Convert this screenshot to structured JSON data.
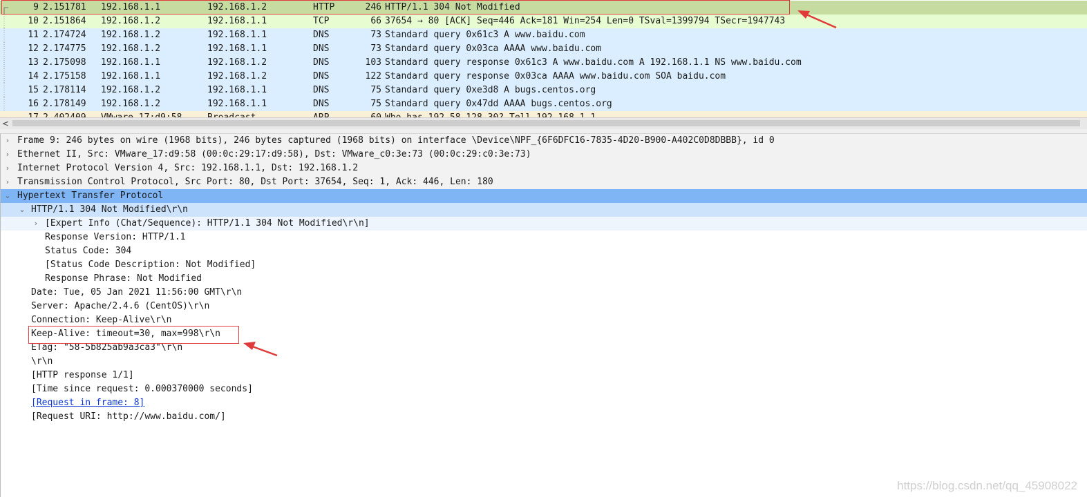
{
  "packet_list": {
    "rows": [
      {
        "no": "9",
        "time": "2.151781",
        "src": "192.168.1.1",
        "dst": "192.168.1.2",
        "proto": "HTTP",
        "len": "246",
        "info": "HTTP/1.1 304 Not Modified"
      },
      {
        "no": "10",
        "time": "2.151864",
        "src": "192.168.1.2",
        "dst": "192.168.1.1",
        "proto": "TCP",
        "len": "66",
        "info": "37654 → 80 [ACK] Seq=446 Ack=181 Win=254 Len=0 TSval=1399794 TSecr=1947743"
      },
      {
        "no": "11",
        "time": "2.174724",
        "src": "192.168.1.2",
        "dst": "192.168.1.1",
        "proto": "DNS",
        "len": "73",
        "info": "Standard query 0x61c3 A www.baidu.com"
      },
      {
        "no": "12",
        "time": "2.174775",
        "src": "192.168.1.2",
        "dst": "192.168.1.1",
        "proto": "DNS",
        "len": "73",
        "info": "Standard query 0x03ca AAAA www.baidu.com"
      },
      {
        "no": "13",
        "time": "2.175098",
        "src": "192.168.1.1",
        "dst": "192.168.1.2",
        "proto": "DNS",
        "len": "103",
        "info": "Standard query response 0x61c3 A www.baidu.com A 192.168.1.1 NS www.baidu.com"
      },
      {
        "no": "14",
        "time": "2.175158",
        "src": "192.168.1.1",
        "dst": "192.168.1.2",
        "proto": "DNS",
        "len": "122",
        "info": "Standard query response 0x03ca AAAA www.baidu.com SOA baidu.com"
      },
      {
        "no": "15",
        "time": "2.178114",
        "src": "192.168.1.2",
        "dst": "192.168.1.1",
        "proto": "DNS",
        "len": "75",
        "info": "Standard query 0xe3d8 A bugs.centos.org"
      },
      {
        "no": "16",
        "time": "2.178149",
        "src": "192.168.1.2",
        "dst": "192.168.1.1",
        "proto": "DNS",
        "len": "75",
        "info": "Standard query 0x47dd AAAA bugs.centos.org"
      },
      {
        "no": "17",
        "time": "2.402409",
        "src": "VMware_17:d9:58",
        "dst": "Broadcast",
        "proto": "ARP",
        "len": "60",
        "info": "Who has 192.58.128.30? Tell 192.168.1.1"
      }
    ]
  },
  "scrollbar": {
    "left_arrow": "<"
  },
  "details": {
    "frame": "Frame 9: 246 bytes on wire (1968 bits), 246 bytes captured (1968 bits) on interface \\Device\\NPF_{6F6DFC16-7835-4D20-B900-A402C0D8DBBB}, id 0",
    "ethernet": "Ethernet II, Src: VMware_17:d9:58 (00:0c:29:17:d9:58), Dst: VMware_c0:3e:73 (00:0c:29:c0:3e:73)",
    "ip": "Internet Protocol Version 4, Src: 192.168.1.1, Dst: 192.168.1.2",
    "tcp": "Transmission Control Protocol, Src Port: 80, Dst Port: 37654, Seq: 1, Ack: 446, Len: 180",
    "http": "Hypertext Transfer Protocol",
    "status_line": "HTTP/1.1 304 Not Modified\\r\\n",
    "expert_info": "[Expert Info (Chat/Sequence): HTTP/1.1 304 Not Modified\\r\\n]",
    "response_version": "Response Version: HTTP/1.1",
    "status_code": "Status Code: 304",
    "status_desc": "[Status Code Description: Not Modified]",
    "response_phrase": "Response Phrase: Not Modified",
    "date": "Date: Tue, 05 Jan 2021 11:56:00 GMT\\r\\n",
    "server": "Server: Apache/2.4.6 (CentOS)\\r\\n",
    "connection": "Connection: Keep-Alive\\r\\n",
    "keep_alive": "Keep-Alive: timeout=30, max=998\\r\\n",
    "etag": "ETag: \"58-5b825ab9a3ca3\"\\r\\n",
    "crlf": "\\r\\n",
    "http_response": "[HTTP response 1/1]",
    "time_since": "[Time since request: 0.000370000 seconds]",
    "request_in_frame": "[Request in frame: 8]",
    "request_uri": "[Request URI: http://www.baidu.com/]"
  },
  "icons": {
    "collapsed": "chevron-right-icon",
    "expanded": "chevron-down-icon"
  },
  "watermark": "https://blog.csdn.net/qq_45908022",
  "colors": {
    "selected_row": "#c6dba0",
    "tcp_row": "#e7fcd0",
    "dns_row": "#daeeff",
    "arp_row": "#faf0d7",
    "selected_detail": "#7fb5f5",
    "annotation": "#e03a3a",
    "link": "#0b37d6"
  }
}
